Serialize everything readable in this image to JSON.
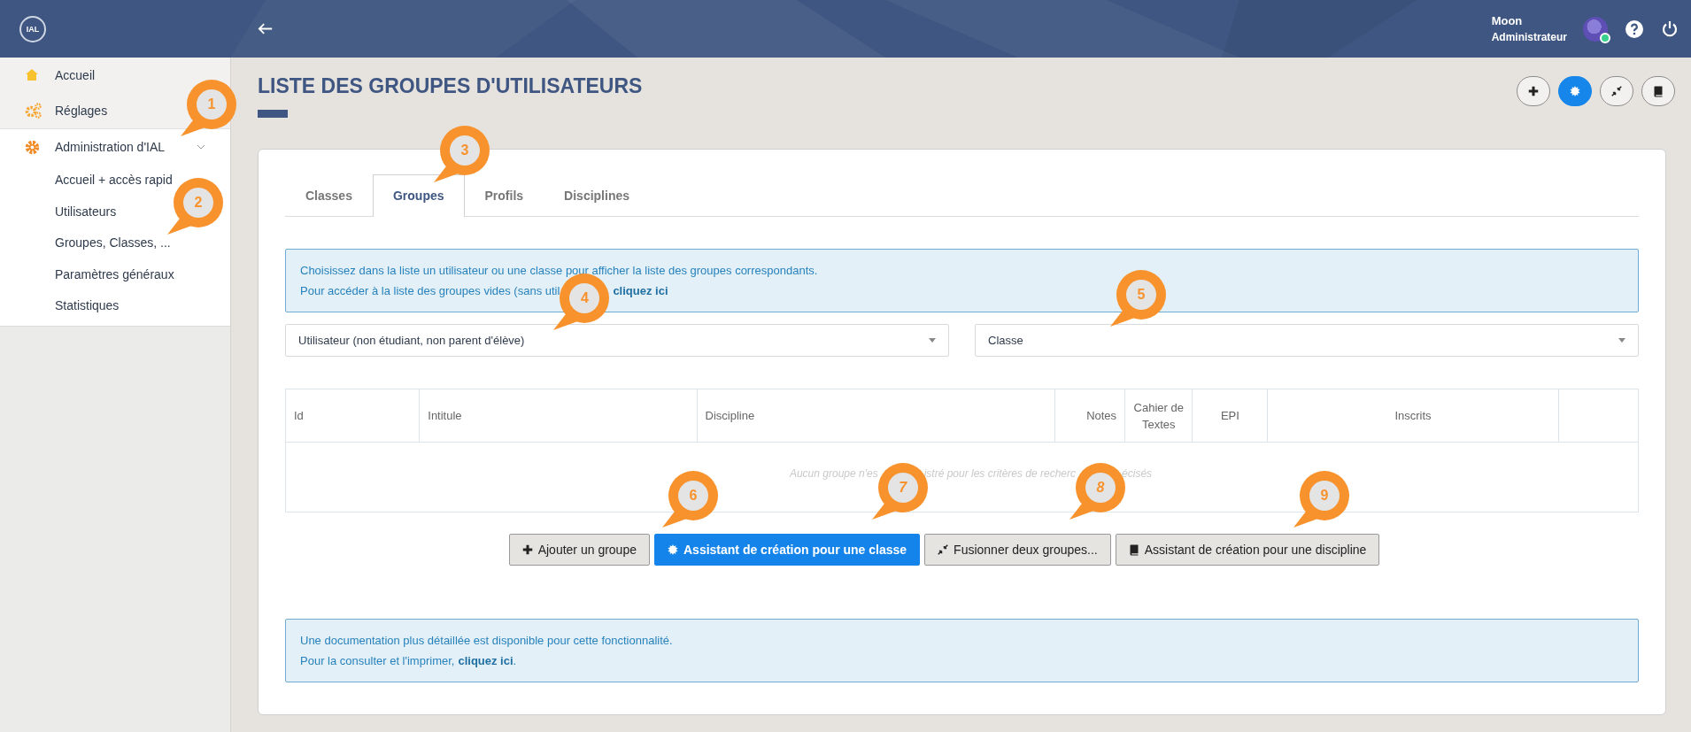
{
  "header": {
    "logo": "IAL",
    "user_name": "Moon",
    "user_role": "Administrateur",
    "online": true
  },
  "sidebar": {
    "items": [
      {
        "kind": "home",
        "label": "Accueil"
      },
      {
        "kind": "gears",
        "label": "Réglages"
      },
      {
        "kind": "gear",
        "label": "Administration d'IAL",
        "expanded": true,
        "children": [
          {
            "label": "Accueil + accès rapid"
          },
          {
            "label": "Utilisateurs"
          },
          {
            "label": "Groupes, Classes, ..."
          },
          {
            "label": "Paramètres généraux"
          },
          {
            "label": "Statistiques"
          }
        ]
      }
    ]
  },
  "page": {
    "title": "LISTE DES GROUPES D'UTILISATEURS",
    "toolbar": [
      {
        "kind": "plus",
        "selected": false
      },
      {
        "kind": "sun",
        "selected": true
      },
      {
        "kind": "merge",
        "selected": false
      },
      {
        "kind": "book",
        "selected": false
      }
    ]
  },
  "tabs": [
    {
      "label": "Classes",
      "selected": false
    },
    {
      "label": "Groupes",
      "selected": true
    },
    {
      "label": "Profils",
      "selected": false
    },
    {
      "label": "Disciplines",
      "selected": false
    }
  ],
  "info": {
    "text": "Choisissez dans la liste un utilisateur ou une classe pour afficher la liste des groupes correspondants.",
    "text_2": "Pour accéder à la liste des groupes vides (sans util",
    "link": "cliquez ici"
  },
  "selects": [
    {
      "value": "Utilisateur (non étudiant, non parent d'élève)"
    },
    {
      "value": "Classe"
    }
  ],
  "table": {
    "columns": [
      "Id",
      "Intitule",
      "Discipline",
      "Notes",
      "Cahier de Textes",
      "EPI",
      "Inscrits"
    ],
    "empty_message_parts": [
      "Aucun groupe n'es",
      "istré pour les critères de recherc",
      "écisés"
    ]
  },
  "actions": [
    {
      "kind": "plus",
      "label": "Ajouter un groupe",
      "primary": false
    },
    {
      "kind": "sun",
      "label": "Assistant de création pour une classe",
      "primary": true
    },
    {
      "kind": "merge",
      "label": "Fusionner deux groupes...",
      "primary": false
    },
    {
      "kind": "book",
      "label": "Assistant de création pour une discipline",
      "primary": false
    }
  ],
  "doc": {
    "text": "Une documentation plus détaillée est disponible pour cette fonctionnalité.",
    "text_2": "Pour la consulter et l'imprimer,",
    "link": "cliquez ici",
    "after": "."
  },
  "callouts": [
    {
      "number": "1"
    },
    {
      "number": "2"
    },
    {
      "number": "3"
    },
    {
      "number": "4"
    },
    {
      "number": "5"
    },
    {
      "number": "6"
    },
    {
      "number": "7"
    },
    {
      "number": "8"
    },
    {
      "number": "9"
    }
  ]
}
